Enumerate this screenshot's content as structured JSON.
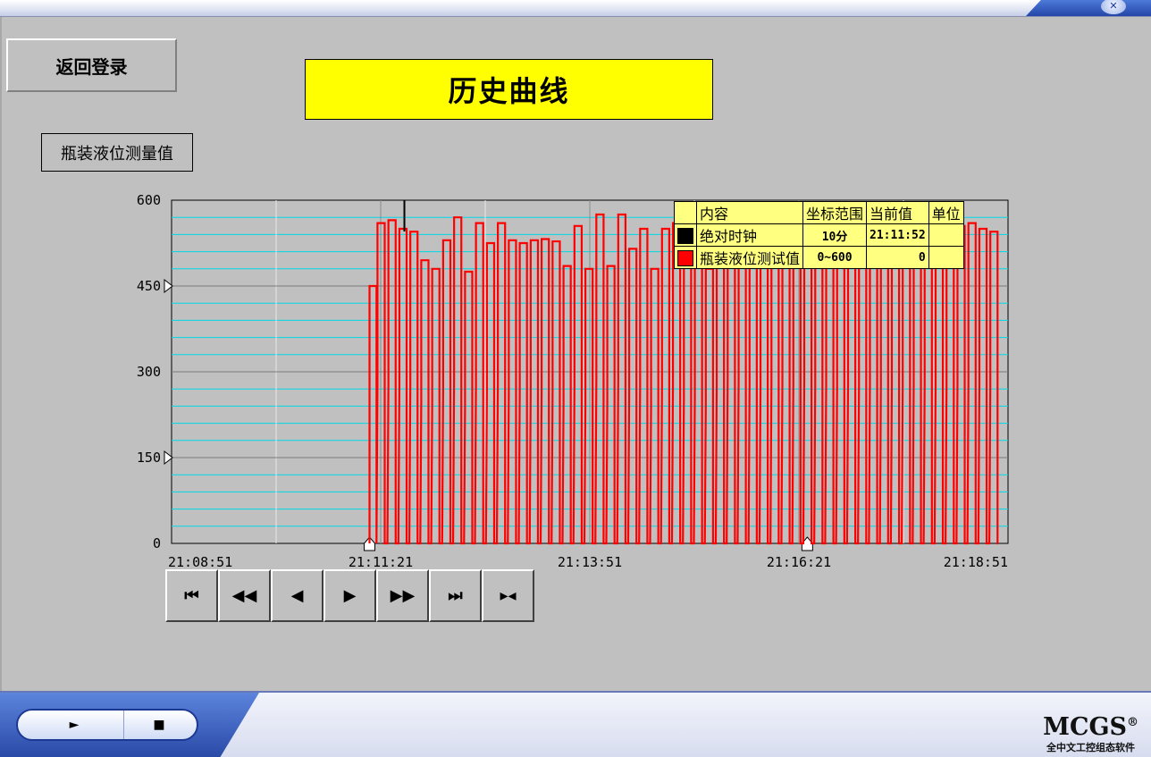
{
  "window": {
    "close_glyph": "✕"
  },
  "back_button": "返回登录",
  "title": "历史曲线",
  "data_label": "瓶装液位测量值",
  "legend": {
    "headers": [
      "内容",
      "坐标范围",
      "当前值",
      "单位"
    ],
    "rows": [
      {
        "color": "#000000",
        "name": "绝对时钟",
        "range": "10分",
        "value": "21:11:52",
        "unit": ""
      },
      {
        "color": "#ff0000",
        "name": "瓶装液位测试值",
        "range": "0~600",
        "value": "0",
        "unit": ""
      }
    ]
  },
  "nav_buttons": [
    {
      "icon": "first-icon",
      "glyph": "⏮"
    },
    {
      "icon": "fast-back-icon",
      "glyph": "◀◀"
    },
    {
      "icon": "back-icon",
      "glyph": "◀"
    },
    {
      "icon": "forward-icon",
      "glyph": "▶"
    },
    {
      "icon": "fast-forward-icon",
      "glyph": "▶▶"
    },
    {
      "icon": "last-icon",
      "glyph": "⏭"
    },
    {
      "icon": "cursor-icon",
      "glyph": "▸◂"
    }
  ],
  "bottom": {
    "play_glyph": "►",
    "stop_glyph": "■"
  },
  "logo": {
    "main": "MCGS",
    "reg": "®",
    "sub": "全中文工控组态软件"
  },
  "chart_data": {
    "type": "line",
    "ylim": [
      0,
      600
    ],
    "y_ticks": [
      0,
      150,
      300,
      450,
      600
    ],
    "x_tick_labels": [
      "21:08:51",
      "21:11:21",
      "21:13:51",
      "21:16:21",
      "21:18:51"
    ],
    "x_range_seconds": 600,
    "grid": true,
    "series": [
      {
        "color": "#ff0000",
        "start_second": 142,
        "initial_value": 450,
        "cycle_seconds": 7.85,
        "peaks": [
          560,
          565,
          550,
          545,
          495,
          480,
          530,
          570,
          475,
          560,
          525,
          560,
          530,
          525,
          530,
          532,
          528,
          485,
          555,
          480,
          575,
          485,
          575,
          515,
          550,
          480,
          550,
          560,
          510,
          510,
          480,
          560,
          575,
          570,
          560,
          545,
          570,
          565,
          560,
          570,
          555,
          560,
          550,
          560,
          555,
          560,
          550,
          545,
          555,
          560,
          550,
          545,
          550,
          555,
          560,
          550,
          545,
          550
        ]
      }
    ],
    "legend_position": "top-right"
  }
}
